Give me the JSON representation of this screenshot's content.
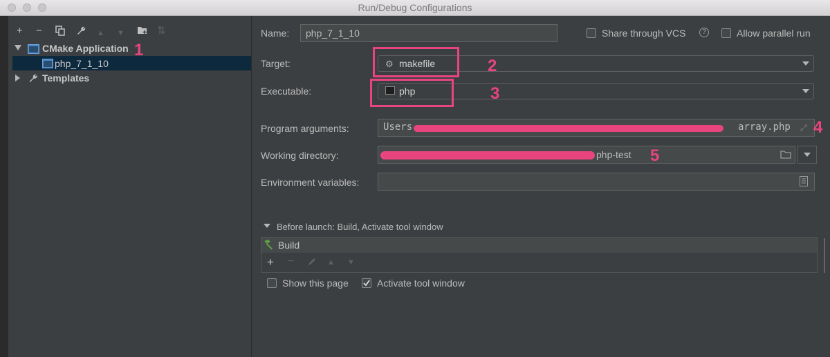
{
  "window": {
    "title": "Run/Debug Configurations"
  },
  "toolbar": {
    "add": "+",
    "remove": "−",
    "copy": "⧉",
    "edit": "🔧",
    "up": "▲",
    "down": "▼",
    "folder": "📁",
    "sort": "⇅"
  },
  "tree": {
    "group_label": "CMake Application",
    "item_label": "php_7_1_10",
    "templates_label": "Templates"
  },
  "form": {
    "name_label": "Name:",
    "name_value": "php_7_1_10",
    "share_label": "Share through VCS",
    "parallel_label": "Allow parallel run",
    "target_label": "Target:",
    "target_value": "makefile",
    "executable_label": "Executable:",
    "executable_value": "php",
    "args_label": "Program arguments:",
    "args_value": "Users",
    "args_value_end": "array.php",
    "workdir_label": "Working directory:",
    "workdir_value": "php-test",
    "env_label": "Environment variables:"
  },
  "before_launch": {
    "header": "Before launch: Build, Activate tool window",
    "items": [
      "Build"
    ],
    "show_page_label": "Show this page",
    "activate_label": "Activate tool window",
    "activate_checked": true,
    "show_page_checked": false
  },
  "annotations": [
    "1",
    "2",
    "3",
    "4",
    "5"
  ]
}
